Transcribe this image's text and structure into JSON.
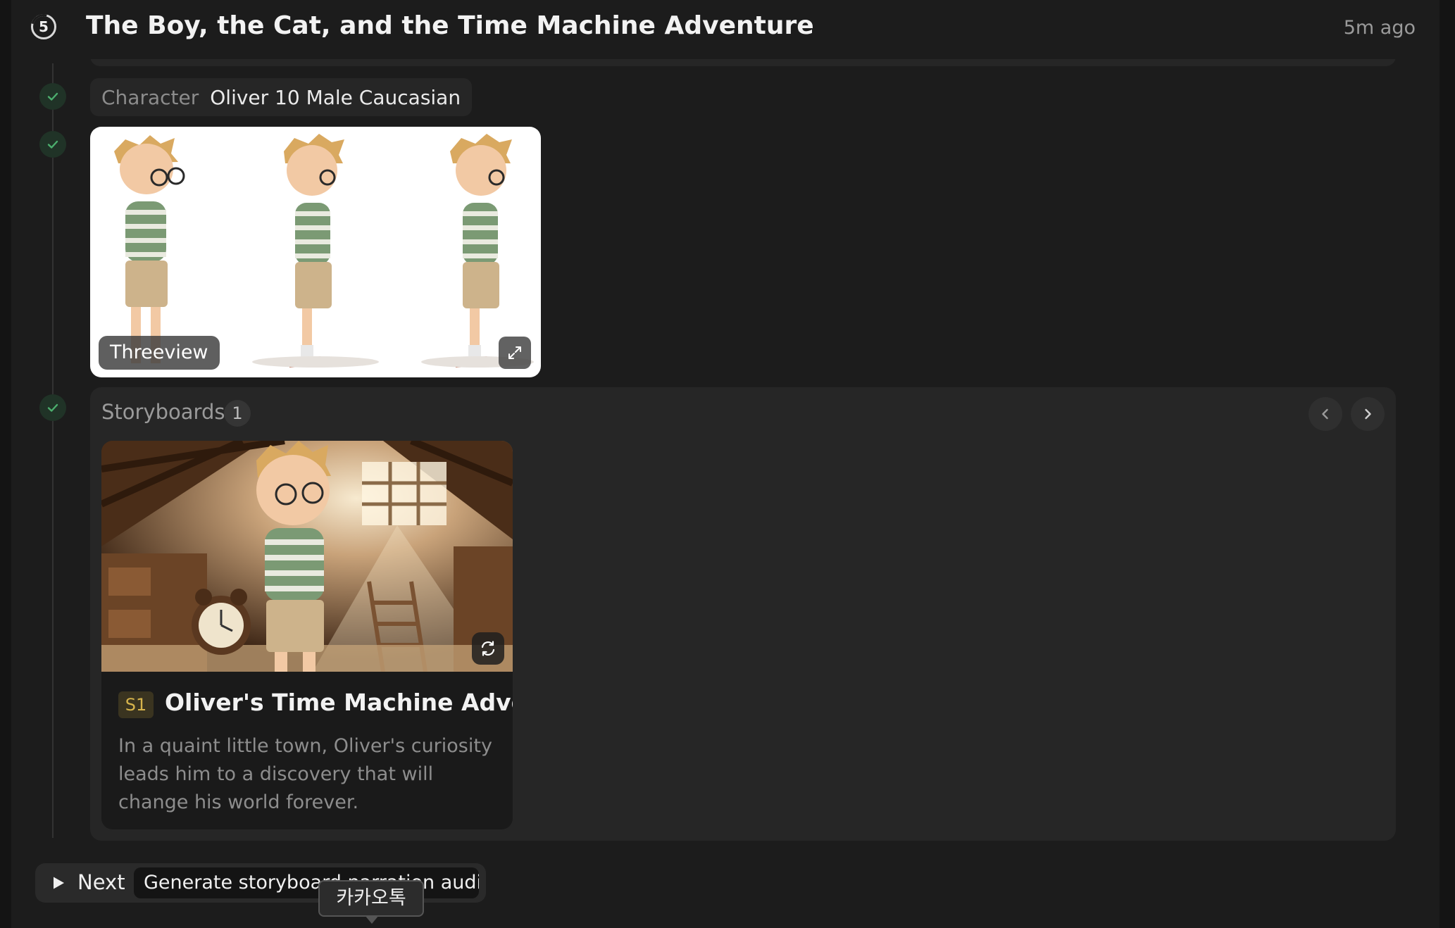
{
  "header": {
    "step_number": "5",
    "title": "The Boy, the Cat, and the Time Machine Adventure",
    "time_ago": "5m ago"
  },
  "character": {
    "label": "Character",
    "value": "Oliver 10 Male Caucasian"
  },
  "threeview": {
    "label": "Threeview"
  },
  "storyboards": {
    "label": "Storyboards",
    "count": "1",
    "items": [
      {
        "badge": "S1",
        "title": "Oliver's Time Machine Adve...",
        "description": "In a quaint little town, Oliver's curiosity leads him to a discovery that will change his world forever."
      }
    ]
  },
  "next": {
    "label": "Next",
    "task": "Generate storyboard narration audios"
  },
  "tooltip": {
    "text": "카카오톡"
  },
  "colors": {
    "background": "#1c1c1c",
    "card": "#262626",
    "check_green": "#4caf6e",
    "badge_gold": "#d6b44c"
  }
}
